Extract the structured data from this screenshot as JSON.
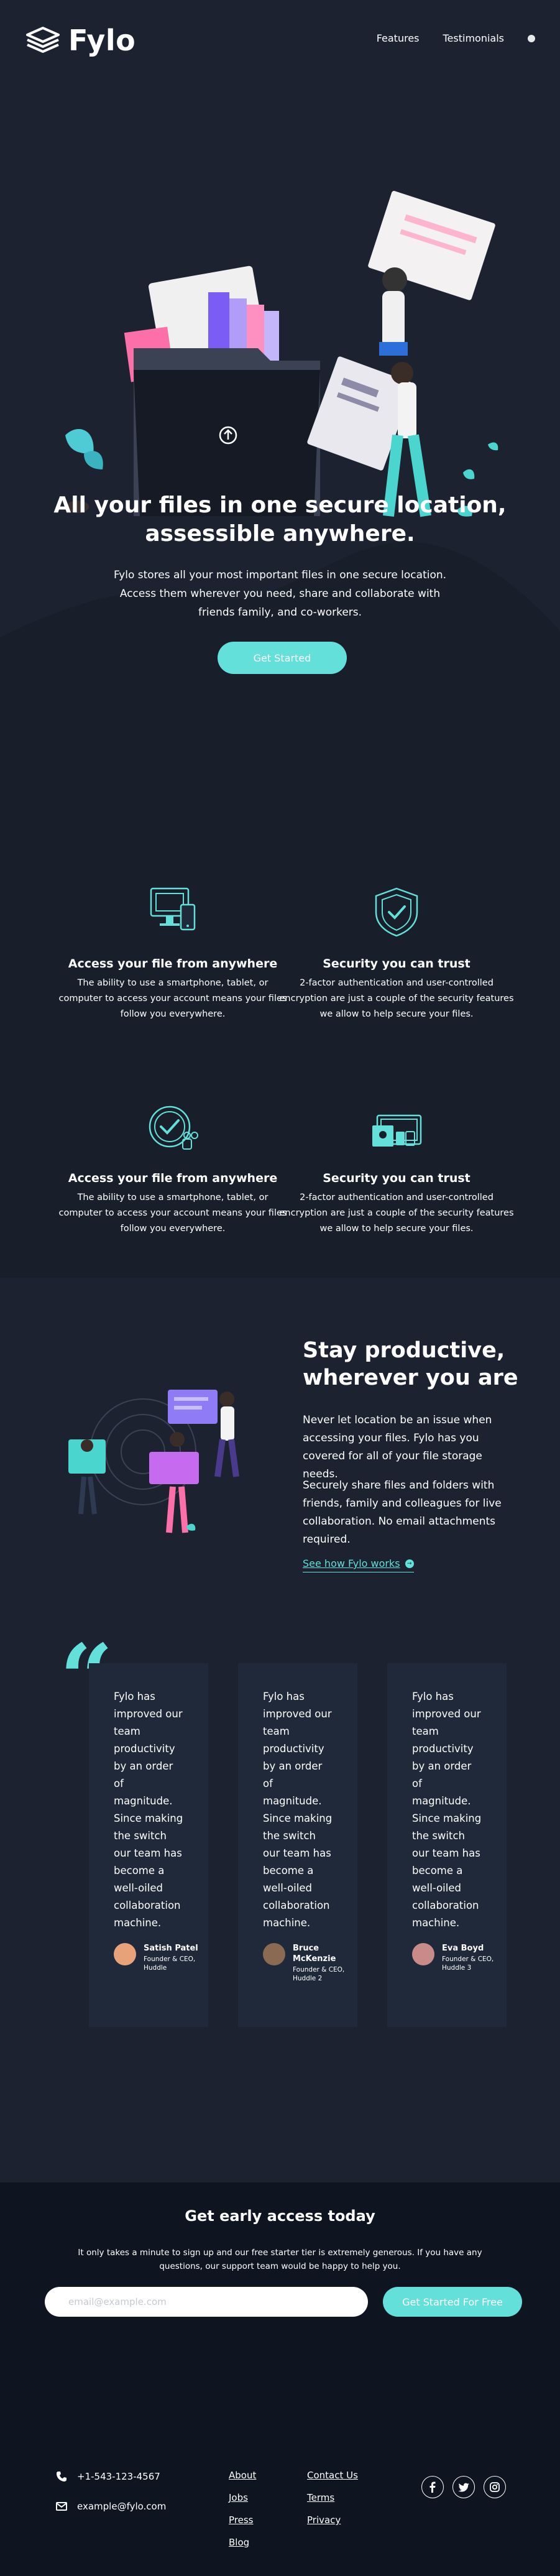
{
  "header": {
    "logo_text": "Fylo",
    "nav": [
      {
        "label": "Features"
      },
      {
        "label": "Testimonials"
      }
    ]
  },
  "hero": {
    "title_line1": "All your files in one secure location,",
    "title_line2": "assessible anywhere.",
    "text": "Fylo stores all your most important files in one secure location. Access them wherever you need, share and collaborate with friends family, and co-workers.",
    "cta_label": "Get Started"
  },
  "features": [
    {
      "title": "Access your file from anywhere",
      "text": "The ability to use a smartphone, tablet, or computer to access your account means your files follow you everywhere."
    },
    {
      "title": "Security you can trust",
      "text": "2-factor authentication and user-controlled encryption are just a couple of the security features we allow to help secure your files."
    },
    {
      "title": "Access your file from anywhere",
      "text": "The ability to use a smartphone, tablet, or computer to access your account means your files follow you everywhere."
    },
    {
      "title": "Security you can trust",
      "text": "2-factor authentication and user-controlled encryption are just a couple of the security features we allow to help secure your files."
    }
  ],
  "productive": {
    "title": "Stay productive, wherever you are",
    "p1": "Never let location be an issue when accessing your files. Fylo has you covered for all of your file storage needs.",
    "p2": "Securely share files and folders with friends, family and colleagues for live collaboration. No email attachments required.",
    "link_label": "See how Fylo works"
  },
  "testimonials": {
    "quote_mark": "“",
    "items": [
      {
        "text": "Fylo has improved our team productivity by an order of magnitude. Since making the switch our team has become a well-oiled collaboration machine.",
        "name": "Satish Patel",
        "role": "Founder & CEO, Huddle"
      },
      {
        "text": "Fylo has improved our team productivity by an order of magnitude. Since making the switch our team has become a well-oiled collaboration machine.",
        "name": "Bruce McKenzie",
        "role": "Founder & CEO, Huddle 2"
      },
      {
        "text": "Fylo has improved our team productivity by an order of magnitude. Since making the switch our team has become a well-oiled collaboration machine.",
        "name": "Eva Boyd",
        "role": "Founder & CEO, Huddle 3"
      }
    ]
  },
  "cta": {
    "title": "Get early access today",
    "text": "It only takes a minute to sign up and our free starter tier is extremely generous. If you have any questions, our support team would be happy to help you.",
    "email_placeholder": "email@example.com",
    "button_label": "Get Started For Free"
  },
  "footer": {
    "phone": "+1-543-123-4567",
    "email": "example@fylo.com",
    "links_col1": [
      "About",
      "Jobs",
      "Press",
      "Blog"
    ],
    "links_col2": [
      "Contact Us",
      "Terms",
      "Privacy"
    ],
    "social": [
      "facebook-icon",
      "twitter-icon",
      "instagram-icon"
    ]
  },
  "colors": {
    "accent": "#62e0d9",
    "background": "#1c2230",
    "features_bg": "#181e2a",
    "card_bg": "#20293a",
    "footer_bg": "#0e1520"
  }
}
